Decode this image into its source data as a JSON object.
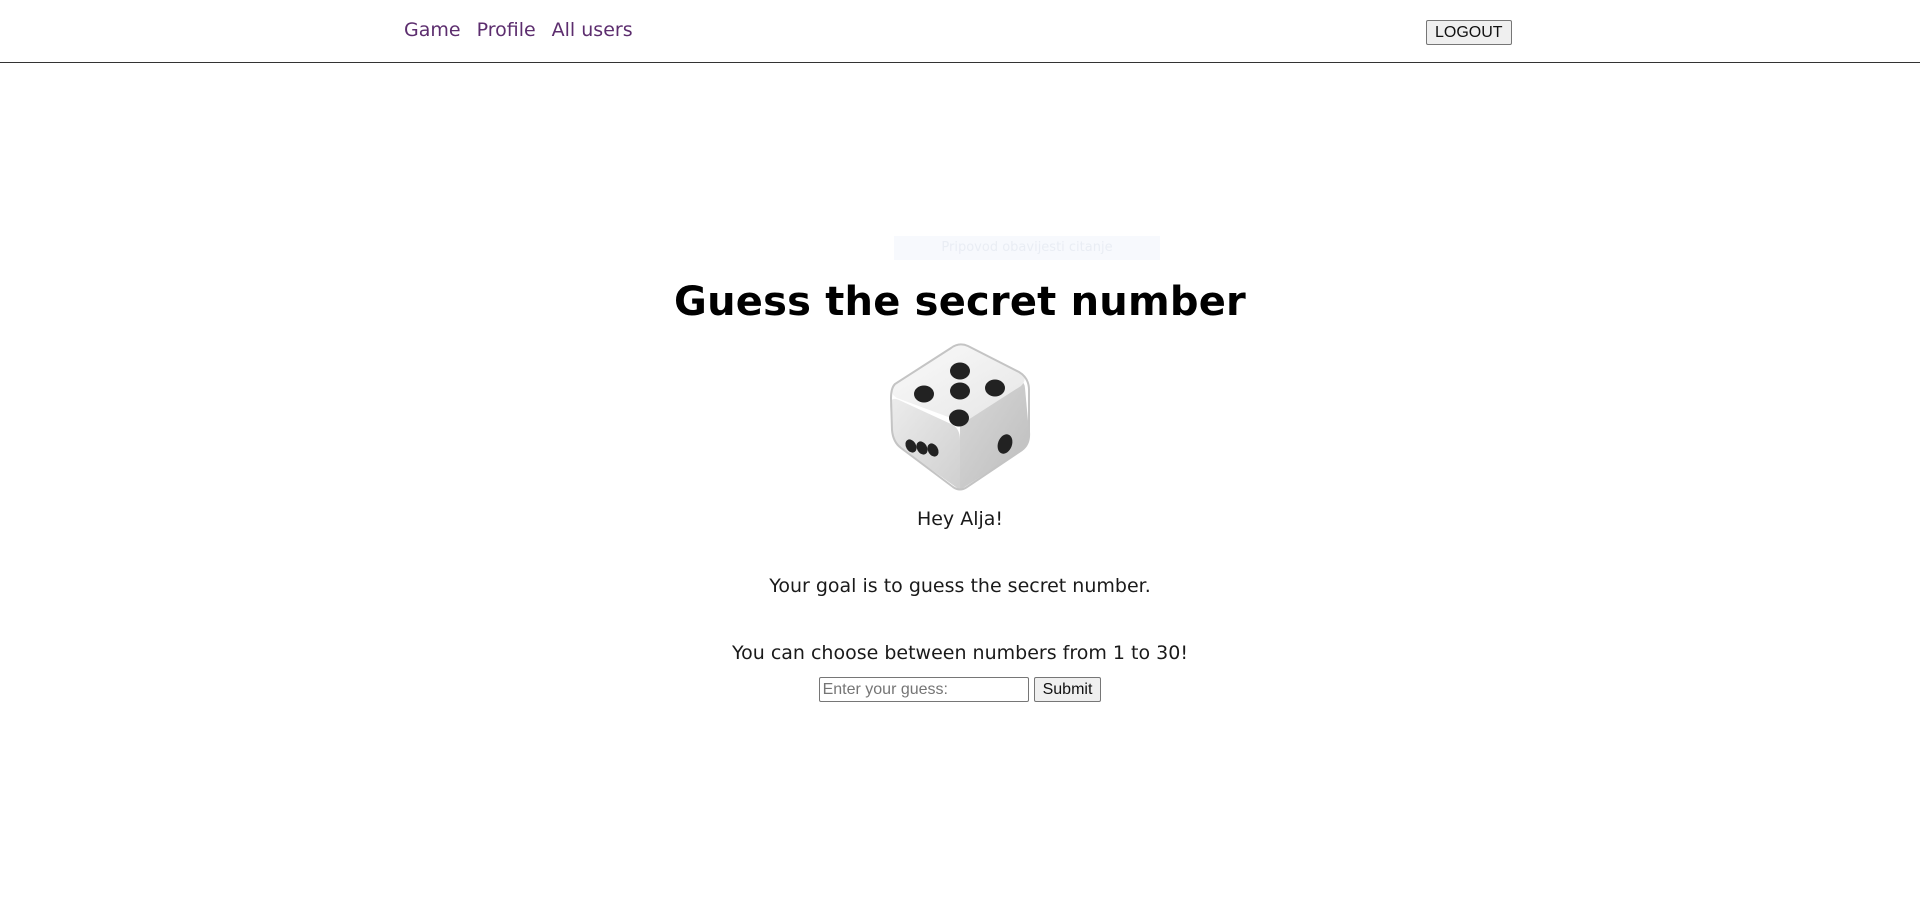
{
  "nav": {
    "links": [
      {
        "label": "Game"
      },
      {
        "label": "Profile"
      },
      {
        "label": "All users"
      }
    ],
    "logout_label": "LOGOUT"
  },
  "main": {
    "faint_text": "Pripovod obavijesti citanje",
    "title": "Guess the secret number",
    "image_icon": "dice-icon",
    "greeting": "Hey Alja!",
    "goal_text": "Your goal is to guess the secret number.",
    "range_text": "You can choose between numbers from 1 to 30!"
  },
  "form": {
    "guess_placeholder": "Enter your guess:",
    "guess_value": "",
    "submit_label": "Submit"
  },
  "colors": {
    "nav_link": "#5c2d6e",
    "title": "#000000",
    "divider": "#333333"
  }
}
